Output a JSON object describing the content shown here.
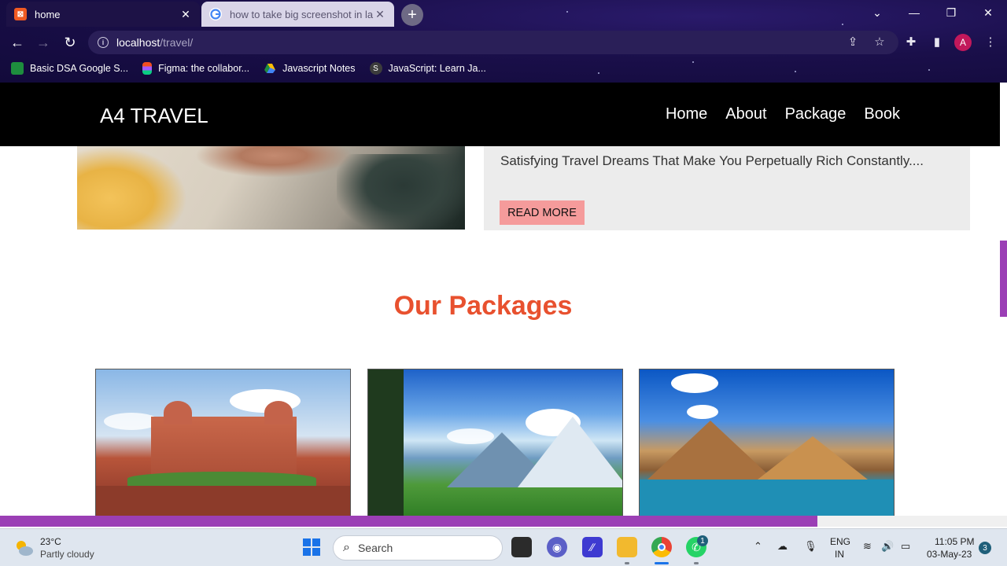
{
  "browser": {
    "tabs": [
      {
        "title": "home",
        "active": true
      },
      {
        "title": "how to take big screenshot in lap",
        "active": false
      }
    ],
    "new_tab_glyph": "+",
    "address": {
      "host": "localhost",
      "path": "/travel/"
    },
    "avatar_letter": "A",
    "bookmarks": [
      {
        "label": "Basic DSA Google S...",
        "icon": "sheets-icon",
        "color": "#1e8e3e"
      },
      {
        "label": "Figma: the collabor...",
        "icon": "figma-icon",
        "color": "#a259ff"
      },
      {
        "label": "Javascript Notes",
        "icon": "drive-icon",
        "color": "#fbbc04"
      },
      {
        "label": "JavaScript: Learn Ja...",
        "icon": "javascript-icon",
        "color": "#3c3c3c"
      }
    ]
  },
  "site": {
    "brand": "A4 TRAVEL",
    "nav": [
      "Home",
      "About",
      "Package",
      "Book"
    ],
    "hero_text": "Satisfying Travel Dreams That Make You Perpetually Rich Constantly....",
    "read_more": "READ MORE",
    "packages_title": "Our Packages",
    "accent_color": "#e8512f",
    "scrollbar_color": "#9b3fb5"
  },
  "taskbar": {
    "weather_temp": "23°C",
    "weather_desc": "Partly cloudy",
    "search_placeholder": "Search",
    "lang_line1": "ENG",
    "lang_line2": "IN",
    "time": "11:05 PM",
    "date": "03-May-23",
    "notification_count": "3",
    "whatsapp_badge": "1"
  }
}
